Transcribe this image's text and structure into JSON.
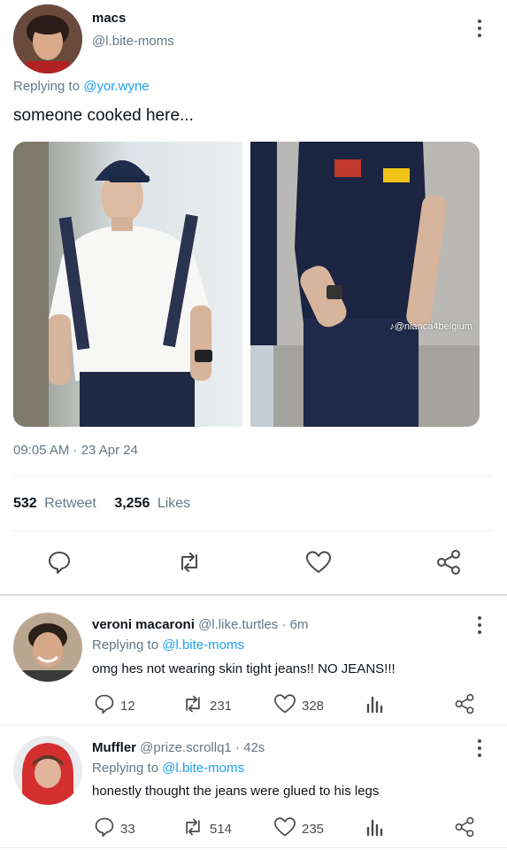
{
  "tweet": {
    "author_name": "macs",
    "author_handle": "@l.bite-moms",
    "replying_prefix": "Replying to",
    "replying_to": "@yor.wyne",
    "text": "someone cooked here...",
    "image_watermark": "@nianca4belgium",
    "timestamp": "09:05 AM · 23 Apr 24",
    "retweet_count": "532",
    "retweet_label": "Retweet",
    "like_count": "3,256",
    "like_label": "Likes"
  },
  "replies": [
    {
      "name": "veroni macaroni",
      "handle_time": "@l.like.turtles · 6m",
      "replying_prefix": "Replying to",
      "replying_to": "@l.bite-moms",
      "text": "omg hes not wearing skin tight jeans!! NO JEANS!!!",
      "replies": "12",
      "retweets": "231",
      "likes": "328"
    },
    {
      "name": "Muffler",
      "handle_time": "@prize.scrollq1 · 42s",
      "replying_prefix": "Replying to",
      "replying_to": "@l.bite-moms",
      "text": "honestly thought the jeans were glued to his legs",
      "replies": "33",
      "retweets": "514",
      "likes": "235"
    }
  ],
  "colors": {
    "link": "#1da1f2",
    "muted": "#657786",
    "icon": "#4a4a4a"
  }
}
